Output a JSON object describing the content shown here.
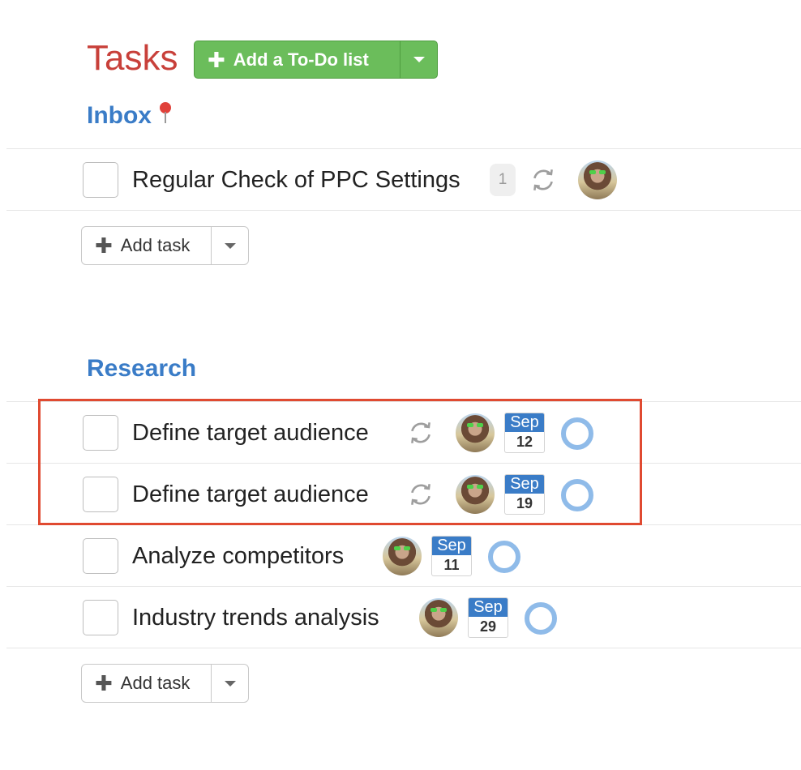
{
  "header": {
    "title": "Tasks",
    "add_list_label": "Add a To-Do list"
  },
  "colors": {
    "title": "#c8403a",
    "section_title": "#3a7cc7",
    "add_list_button": "#6bbd5b",
    "date_month": "#3a7cc7",
    "status_ring": "#8fbbe9",
    "highlight": "#e04a31"
  },
  "lists": [
    {
      "title": "Inbox",
      "title_icon": "pin-icon",
      "tasks": [
        {
          "title": "Regular Check of PPC Settings",
          "comment_count": "1",
          "repeat_icon": "repeat-icon",
          "assignee_icon": "avatar"
        }
      ],
      "add_task_label": "Add task"
    },
    {
      "title": "Research",
      "tasks": [
        {
          "title": "Define target audience",
          "repeat_icon": "repeat-icon",
          "assignee_icon": "avatar",
          "due_month": "Sep",
          "due_day": "12",
          "status_icon": "status-ring-icon"
        },
        {
          "title": "Define target audience",
          "repeat_icon": "repeat-icon",
          "assignee_icon": "avatar",
          "due_month": "Sep",
          "due_day": "19",
          "status_icon": "status-ring-icon"
        },
        {
          "title": "Analyze competitors",
          "assignee_icon": "avatar",
          "due_month": "Sep",
          "due_day": "11",
          "status_icon": "status-ring-icon"
        },
        {
          "title": "Industry trends analysis",
          "assignee_icon": "avatar",
          "due_month": "Sep",
          "due_day": "29",
          "status_icon": "status-ring-icon"
        }
      ],
      "add_task_label": "Add task"
    }
  ]
}
